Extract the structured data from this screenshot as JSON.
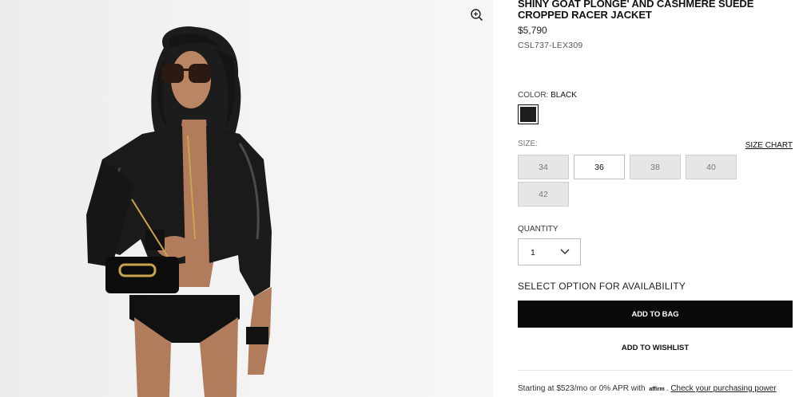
{
  "product": {
    "title": "SHINY GOAT PLONGE' AND CASHMERE SUEDE CROPPED RACER JACKET",
    "price": "$5,790",
    "sku": "CSL737-LEX309"
  },
  "color": {
    "label": "COLOR:",
    "selected": "BLACK",
    "swatch_color": "#1d1d1d"
  },
  "size": {
    "label": "SIZE:",
    "chart_link": "SIZE CHART",
    "options": [
      {
        "label": "34",
        "available": false
      },
      {
        "label": "36",
        "available": true
      },
      {
        "label": "38",
        "available": false
      },
      {
        "label": "40",
        "available": false
      },
      {
        "label": "42",
        "available": false
      }
    ]
  },
  "quantity": {
    "label": "QUANTITY",
    "value": "1"
  },
  "availability_text": "SELECT OPTION FOR AVAILABILITY",
  "actions": {
    "add_to_bag": "ADD TO BAG",
    "add_to_wishlist": "ADD TO WISHLIST"
  },
  "financing": {
    "prefix": "Starting at $523/mo or 0% APR with",
    "brand": "affirm",
    "link": "Check your purchasing power"
  },
  "icons": {
    "zoom": "zoom-in-icon",
    "qty": "chevron-down-icon"
  },
  "colors": {
    "primary_button": "#0a0a0a",
    "unavailable_size_bg": "#e6e6e6"
  }
}
